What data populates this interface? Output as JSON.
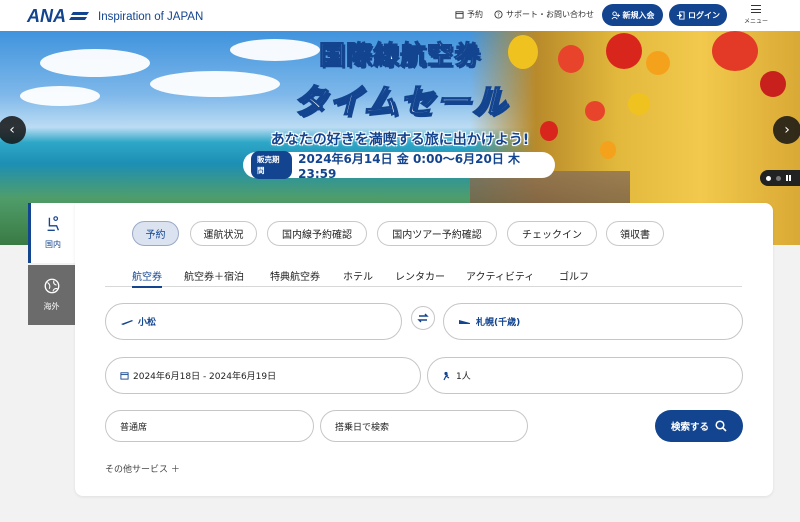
{
  "header": {
    "logo_text": "ANA",
    "tagline": "Inspiration of JAPAN",
    "reservation_link": "予約",
    "support_link": "サポート・お問い合わせ",
    "signup_button": "新規入会",
    "login_button": "ログイン",
    "menu_label": "メニュー"
  },
  "hero": {
    "title_line1": "国際線航空券",
    "title_line2": "タイムセール",
    "subtitle": "あなたの好きを満喫する旅に出かけよう!",
    "sale_tag": "販売期間",
    "sale_dates": "2024年6月14日 金 0:00～6月20日 木 23:59",
    "prev_arrow": "‹",
    "next_arrow": "›"
  },
  "side_tabs": {
    "domestic": "国内",
    "international": "海外"
  },
  "top_pills": [
    "予約",
    "運航状況",
    "国内線予約確認",
    "国内ツアー予約確認",
    "チェックイン",
    "領収書"
  ],
  "sub_tabs": [
    "航空券",
    "航空券＋宿泊",
    "特典航空券",
    "ホテル",
    "レンタカー",
    "アクティビティ",
    "ゴルフ"
  ],
  "form": {
    "from": "小松",
    "to": "札幌(千歳)",
    "dates": "2024年6月18日 - 2024年6月19日",
    "passengers": "1人",
    "seat_class": "普通席",
    "boarding_search": "搭乗日で検索",
    "search_button": "検索する",
    "other_services": "その他サービス ＋"
  },
  "colors": {
    "brand": "#13448f"
  }
}
